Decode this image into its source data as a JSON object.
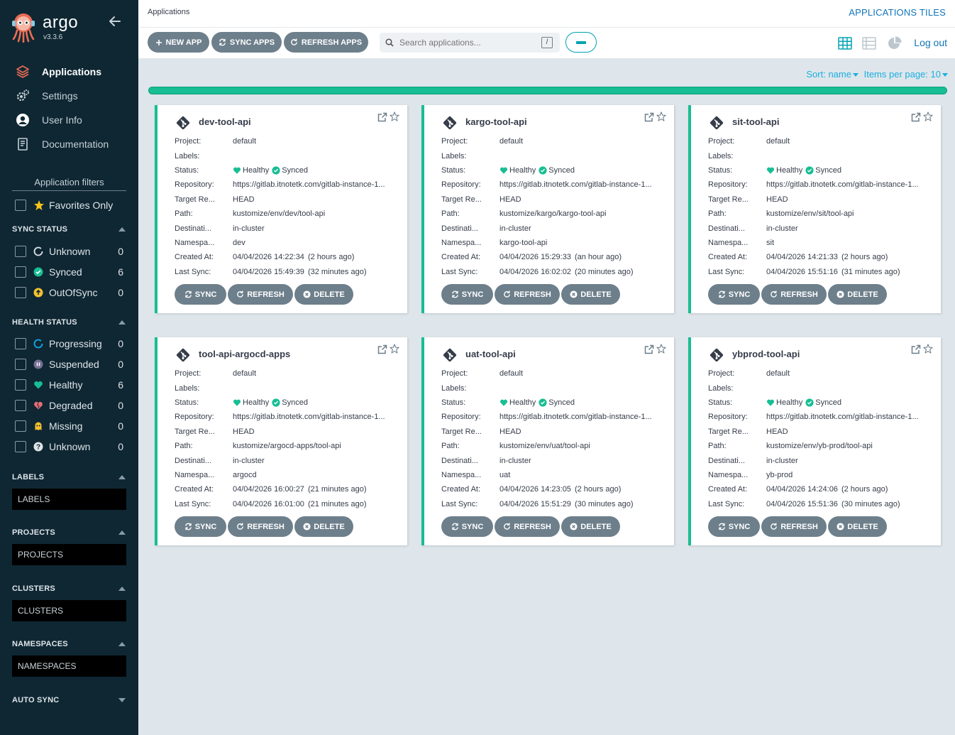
{
  "brand": {
    "name": "argo",
    "version": "v3.3.6"
  },
  "nav": [
    {
      "label": "Applications",
      "icon": "layers-icon",
      "active": true
    },
    {
      "label": "Settings",
      "icon": "gears-icon"
    },
    {
      "label": "User Info",
      "icon": "user-circle-icon"
    },
    {
      "label": "Documentation",
      "icon": "book-icon"
    }
  ],
  "filters": {
    "title": "Application filters",
    "favorites_label": "Favorites Only",
    "sync_status": {
      "title": "SYNC STATUS",
      "items": [
        {
          "label": "Unknown",
          "count": "0"
        },
        {
          "label": "Synced",
          "count": "6"
        },
        {
          "label": "OutOfSync",
          "count": "0"
        }
      ]
    },
    "health_status": {
      "title": "HEALTH STATUS",
      "items": [
        {
          "label": "Progressing",
          "count": "0"
        },
        {
          "label": "Suspended",
          "count": "0"
        },
        {
          "label": "Healthy",
          "count": "6"
        },
        {
          "label": "Degraded",
          "count": "0"
        },
        {
          "label": "Missing",
          "count": "0"
        },
        {
          "label": "Unknown",
          "count": "0"
        }
      ]
    },
    "labels": {
      "title": "LABELS",
      "placeholder": "LABELS"
    },
    "projects": {
      "title": "PROJECTS",
      "placeholder": "PROJECTS"
    },
    "clusters": {
      "title": "CLUSTERS",
      "placeholder": "CLUSTERS"
    },
    "namespaces": {
      "title": "NAMESPACES",
      "placeholder": "NAMESPACES"
    },
    "auto_sync": {
      "title": "AUTO SYNC"
    }
  },
  "topbar": {
    "breadcrumb": "Applications",
    "title": "APPLICATIONS TILES",
    "logout": "Log out"
  },
  "toolbar": {
    "new_app": "NEW APP",
    "sync_apps": "SYNC APPS",
    "refresh_apps": "REFRESH APPS",
    "search_placeholder": "Search applications...",
    "search_shortcut": "/"
  },
  "sort": {
    "sort_label": "Sort: name",
    "items_label": "Items per page: 10"
  },
  "colors": {
    "accent": "#18be94",
    "sidebar": "#0f2733",
    "button": "#6d7f8b",
    "link": "#1175b9"
  },
  "field_labels": {
    "project": "Project:",
    "labels": "Labels:",
    "status": "Status:",
    "repository": "Repository:",
    "target": "Target Re...",
    "path": "Path:",
    "destination": "Destinati...",
    "namespace": "Namespa...",
    "created": "Created At:",
    "last_sync": "Last Sync:"
  },
  "status_text": {
    "health": "Healthy",
    "sync": "Synced"
  },
  "tile_actions": {
    "sync": "SYNC",
    "refresh": "REFRESH",
    "delete": "DELETE"
  },
  "apps": [
    {
      "name": "dev-tool-api",
      "project": "default",
      "labels": "",
      "repository": "https://gitlab.itnotetk.com/gitlab-instance-1...",
      "target": "HEAD",
      "path": "kustomize/env/dev/tool-api",
      "destination": "in-cluster",
      "namespace": "dev",
      "created": "04/04/2026 14:22:34",
      "created_ago": "(2 hours ago)",
      "last_sync": "04/04/2026 15:49:39",
      "last_sync_ago": "(32 minutes ago)"
    },
    {
      "name": "kargo-tool-api",
      "project": "default",
      "labels": "",
      "repository": "https://gitlab.itnotetk.com/gitlab-instance-1...",
      "target": "HEAD",
      "path": "kustomize/kargo/kargo-tool-api",
      "destination": "in-cluster",
      "namespace": "kargo-tool-api",
      "created": "04/04/2026 15:29:33",
      "created_ago": "(an hour ago)",
      "last_sync": "04/04/2026 16:02:02",
      "last_sync_ago": "(20 minutes ago)"
    },
    {
      "name": "sit-tool-api",
      "project": "default",
      "labels": "",
      "repository": "https://gitlab.itnotetk.com/gitlab-instance-1...",
      "target": "HEAD",
      "path": "kustomize/env/sit/tool-api",
      "destination": "in-cluster",
      "namespace": "sit",
      "created": "04/04/2026 14:21:33",
      "created_ago": "(2 hours ago)",
      "last_sync": "04/04/2026 15:51:16",
      "last_sync_ago": "(31 minutes ago)"
    },
    {
      "name": "tool-api-argocd-apps",
      "project": "default",
      "labels": "",
      "repository": "https://gitlab.itnotetk.com/gitlab-instance-1...",
      "target": "HEAD",
      "path": "kustomize/argocd-apps/tool-api",
      "destination": "in-cluster",
      "namespace": "argocd",
      "created": "04/04/2026 16:00:27",
      "created_ago": "(21 minutes ago)",
      "last_sync": "04/04/2026 16:01:00",
      "last_sync_ago": "(21 minutes ago)"
    },
    {
      "name": "uat-tool-api",
      "project": "default",
      "labels": "",
      "repository": "https://gitlab.itnotetk.com/gitlab-instance-1...",
      "target": "HEAD",
      "path": "kustomize/env/uat/tool-api",
      "destination": "in-cluster",
      "namespace": "uat",
      "created": "04/04/2026 14:23:05",
      "created_ago": "(2 hours ago)",
      "last_sync": "04/04/2026 15:51:29",
      "last_sync_ago": "(30 minutes ago)"
    },
    {
      "name": "ybprod-tool-api",
      "project": "default",
      "labels": "",
      "repository": "https://gitlab.itnotetk.com/gitlab-instance-1...",
      "target": "HEAD",
      "path": "kustomize/env/yb-prod/tool-api",
      "destination": "in-cluster",
      "namespace": "yb-prod",
      "created": "04/04/2026 14:24:06",
      "created_ago": "(2 hours ago)",
      "last_sync": "04/04/2026 15:51:36",
      "last_sync_ago": "(30 minutes ago)"
    }
  ]
}
